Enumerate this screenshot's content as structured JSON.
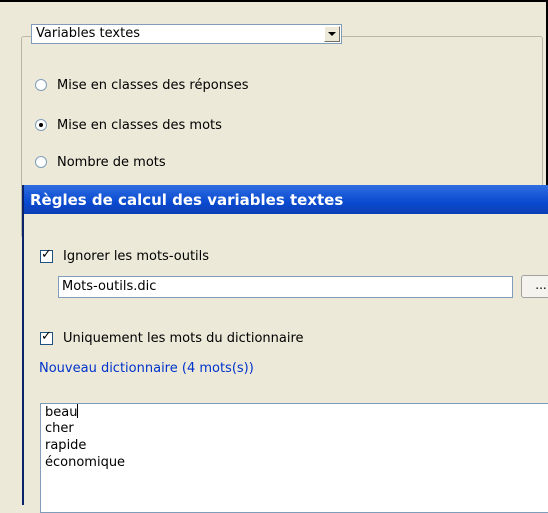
{
  "background_panel": {
    "combo": {
      "value": "Variables textes"
    },
    "radios": [
      {
        "label": "Mise en classes des réponses",
        "checked": false
      },
      {
        "label": "Mise en classes des mots",
        "checked": true
      },
      {
        "label": "Nombre de mots",
        "checked": false
      }
    ]
  },
  "dialog": {
    "title": "Règles de calcul des variables textes",
    "ignore_checkbox": {
      "label": "Ignorer les mots-outils",
      "checked": true
    },
    "stopwords_file": {
      "value": "Mots-outils.dic"
    },
    "browse_button": {
      "label": "..."
    },
    "dictionary_checkbox": {
      "label": "Uniquement les mots du dictionnaire",
      "checked": true
    },
    "dictionary_link": "Nouveau dictionnaire (4 mots(s))",
    "word_list": [
      "beau",
      "cher",
      "rapide",
      "économique"
    ]
  },
  "colors": {
    "accent": "#0a4ad0",
    "link": "#0033cc",
    "background": "#ece9d8"
  }
}
